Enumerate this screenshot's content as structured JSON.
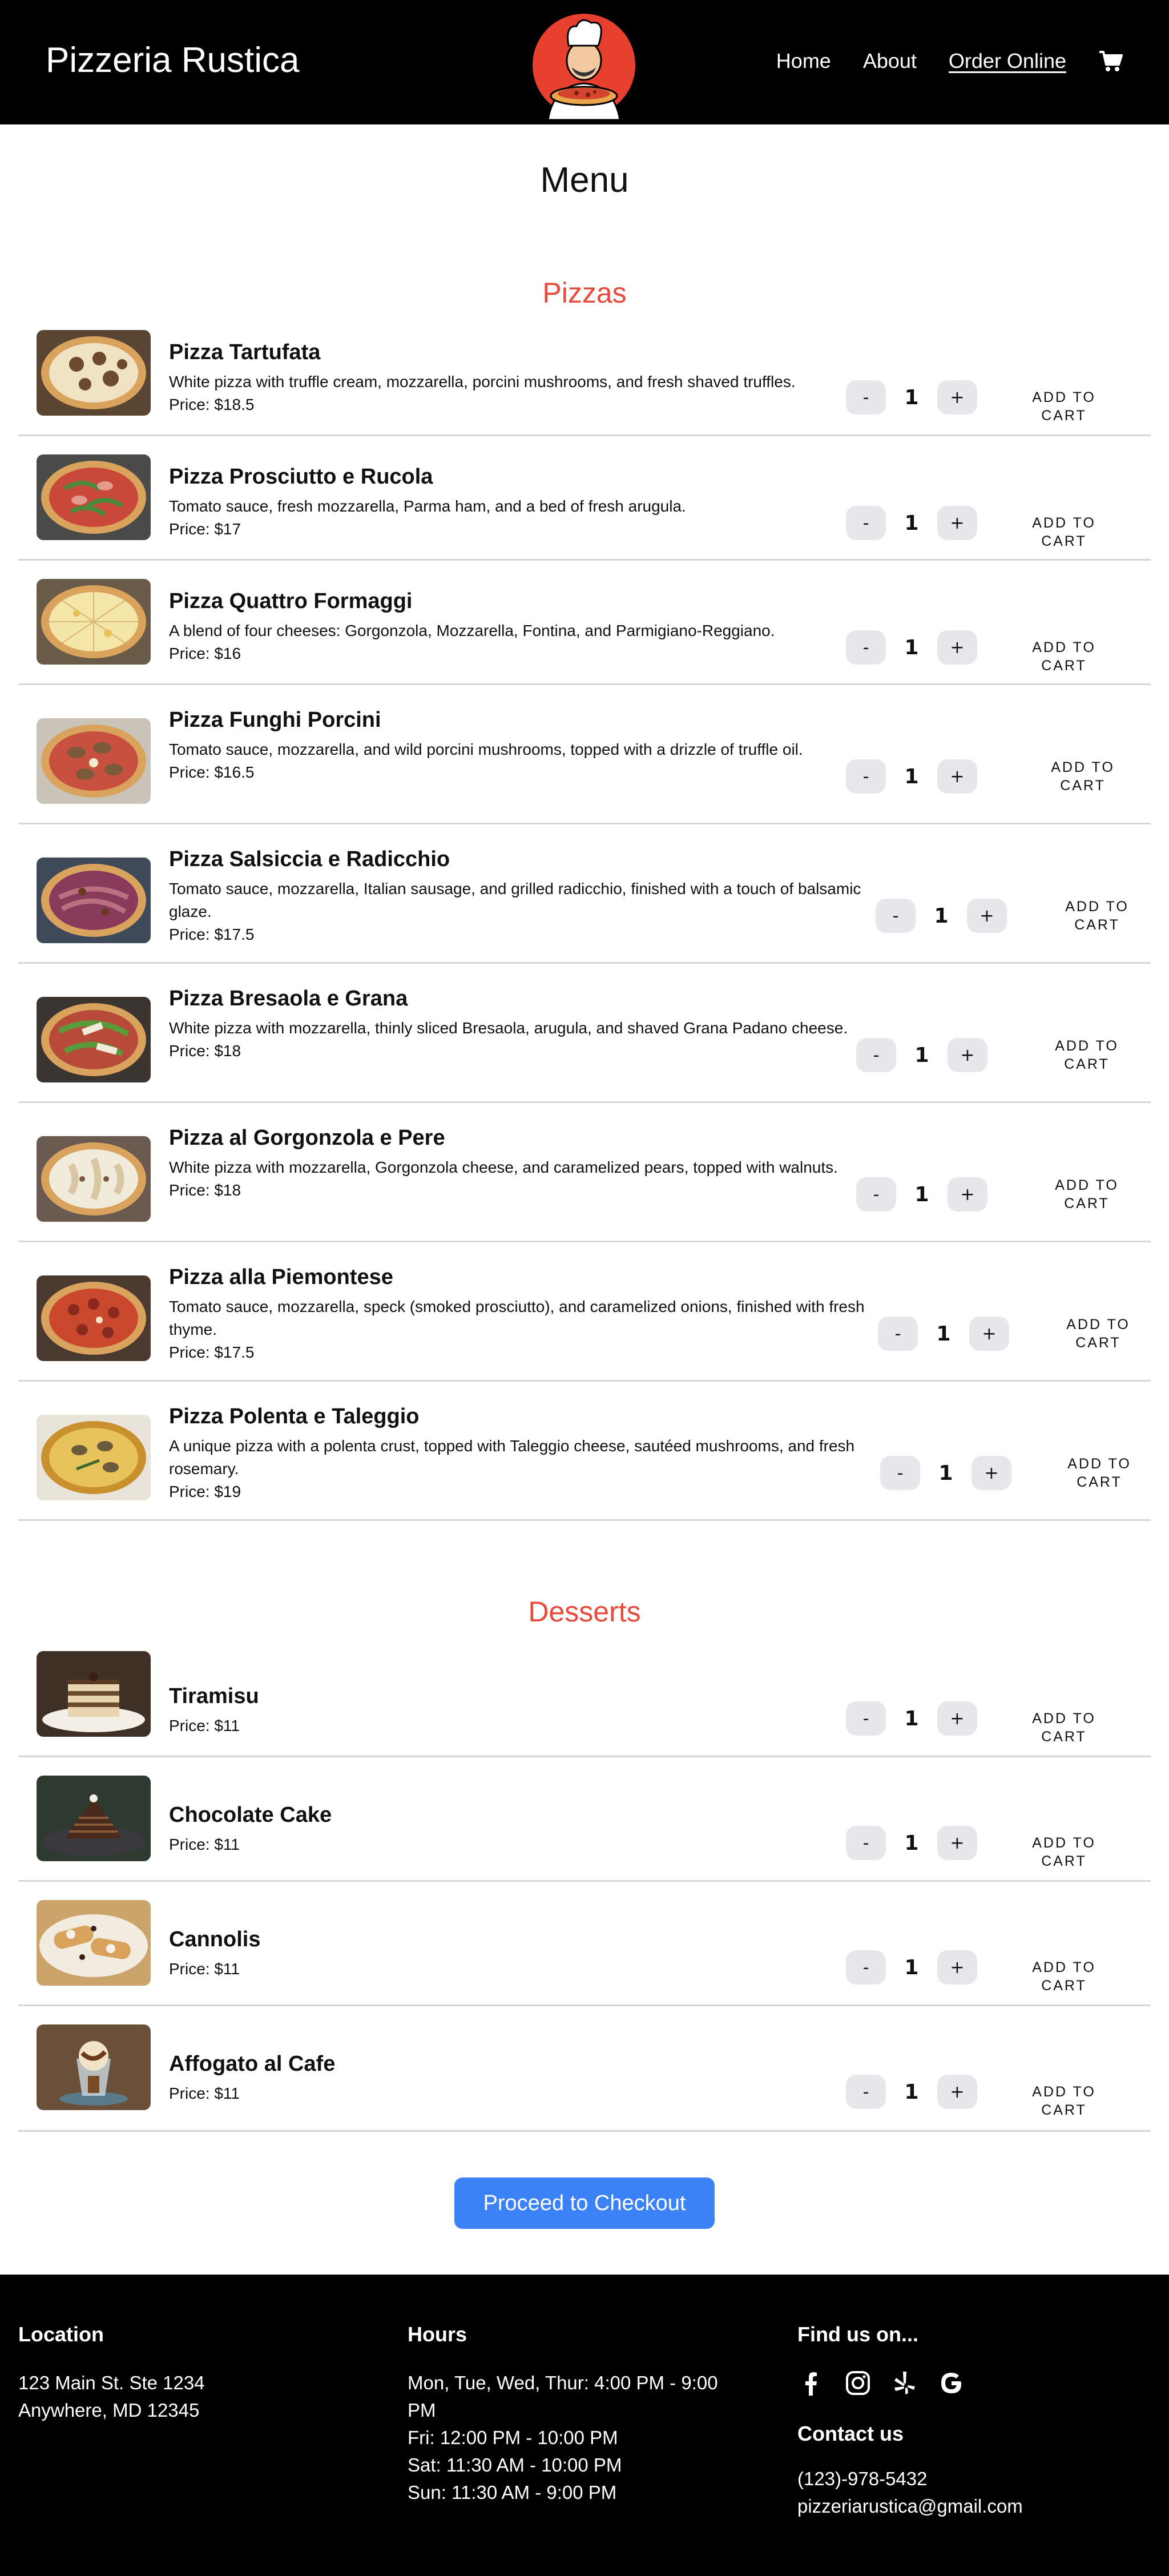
{
  "header": {
    "brand": "Pizzeria Rustica",
    "nav": [
      "Home",
      "About",
      "Order Online"
    ],
    "active_nav": "Order Online",
    "cart_icon": "cart-icon"
  },
  "page_title": "Menu",
  "sections": {
    "pizzas": "Pizzas",
    "desserts": "Desserts"
  },
  "add_to_cart_label": "ADD TO CART",
  "pizzas": [
    {
      "name": "Pizza Tartufata",
      "desc": "White pizza with truffle cream, mozzarella, porcini mushrooms, and fresh shaved truffles.",
      "price": "Price: $18.5",
      "qty": "1"
    },
    {
      "name": "Pizza Prosciutto e Rucola",
      "desc": "Tomato sauce, fresh mozzarella, Parma ham, and a bed of fresh arugula.",
      "price": "Price: $17",
      "qty": "1"
    },
    {
      "name": "Pizza Quattro Formaggi",
      "desc": "A blend of four cheeses: Gorgonzola, Mozzarella, Fontina, and Parmigiano-Reggiano.",
      "price": "Price: $16",
      "qty": "1"
    },
    {
      "name": "Pizza Funghi Porcini",
      "desc": "Tomato sauce, mozzarella, and wild porcini mushrooms, topped with a drizzle of truffle oil.",
      "price": "Price: $16.5",
      "qty": "1"
    },
    {
      "name": "Pizza Salsiccia e Radicchio",
      "desc": "Tomato sauce, mozzarella, Italian sausage, and grilled radicchio, finished with a touch of balsamic glaze.",
      "price": "Price: $17.5",
      "qty": "1"
    },
    {
      "name": "Pizza Bresaola e Grana",
      "desc": "White pizza with mozzarella, thinly sliced Bresaola, arugula, and shaved Grana Padano cheese.",
      "price": "Price: $18",
      "qty": "1"
    },
    {
      "name": "Pizza al Gorgonzola e Pere",
      "desc": "White pizza with mozzarella, Gorgonzola cheese, and caramelized pears, topped with walnuts.",
      "price": "Price: $18",
      "qty": "1"
    },
    {
      "name": "Pizza alla Piemontese",
      "desc": "Tomato sauce, mozzarella, speck (smoked prosciutto), and caramelized onions, finished with fresh thyme.",
      "price": "Price: $17.5",
      "qty": "1"
    },
    {
      "name": "Pizza Polenta e Taleggio",
      "desc": "A unique pizza with a polenta crust, topped with Taleggio cheese, sautéed mushrooms, and fresh rosemary.",
      "price": "Price: $19",
      "qty": "1"
    }
  ],
  "desserts": [
    {
      "name": "Tiramisu",
      "price": "Price: $11",
      "qty": "1"
    },
    {
      "name": "Chocolate Cake",
      "price": "Price: $11",
      "qty": "1"
    },
    {
      "name": "Cannolis",
      "price": "Price: $11",
      "qty": "1"
    },
    {
      "name": "Affogato al Cafe",
      "price": "Price: $11",
      "qty": "1"
    }
  ],
  "checkout_label": "Proceed to Checkout",
  "footer": {
    "location_title": "Location",
    "address_line1": "123 Main St. Ste 1234",
    "address_line2": "Anywhere, MD 12345",
    "hours_title": "Hours",
    "hours": [
      "Mon, Tue, Wed, Thur: 4:00 PM - 9:00 PM",
      "Fri: 12:00 PM - 10:00 PM",
      "Sat: 11:30 AM - 10:00 PM",
      "Sun: 11:30 AM - 9:00 PM"
    ],
    "find_title": "Find us on...",
    "social_icons": [
      "facebook-icon",
      "instagram-icon",
      "yelp-icon",
      "google-icon"
    ],
    "contact_title": "Contact us",
    "phone": "(123)-978-5432",
    "email": "pizzeriarustica@gmail.com"
  },
  "colors": {
    "header_bg": "#000000",
    "section_title": "#e84a3c",
    "checkout_button": "#3b82f6",
    "qty_button": "#e5e7eb"
  }
}
